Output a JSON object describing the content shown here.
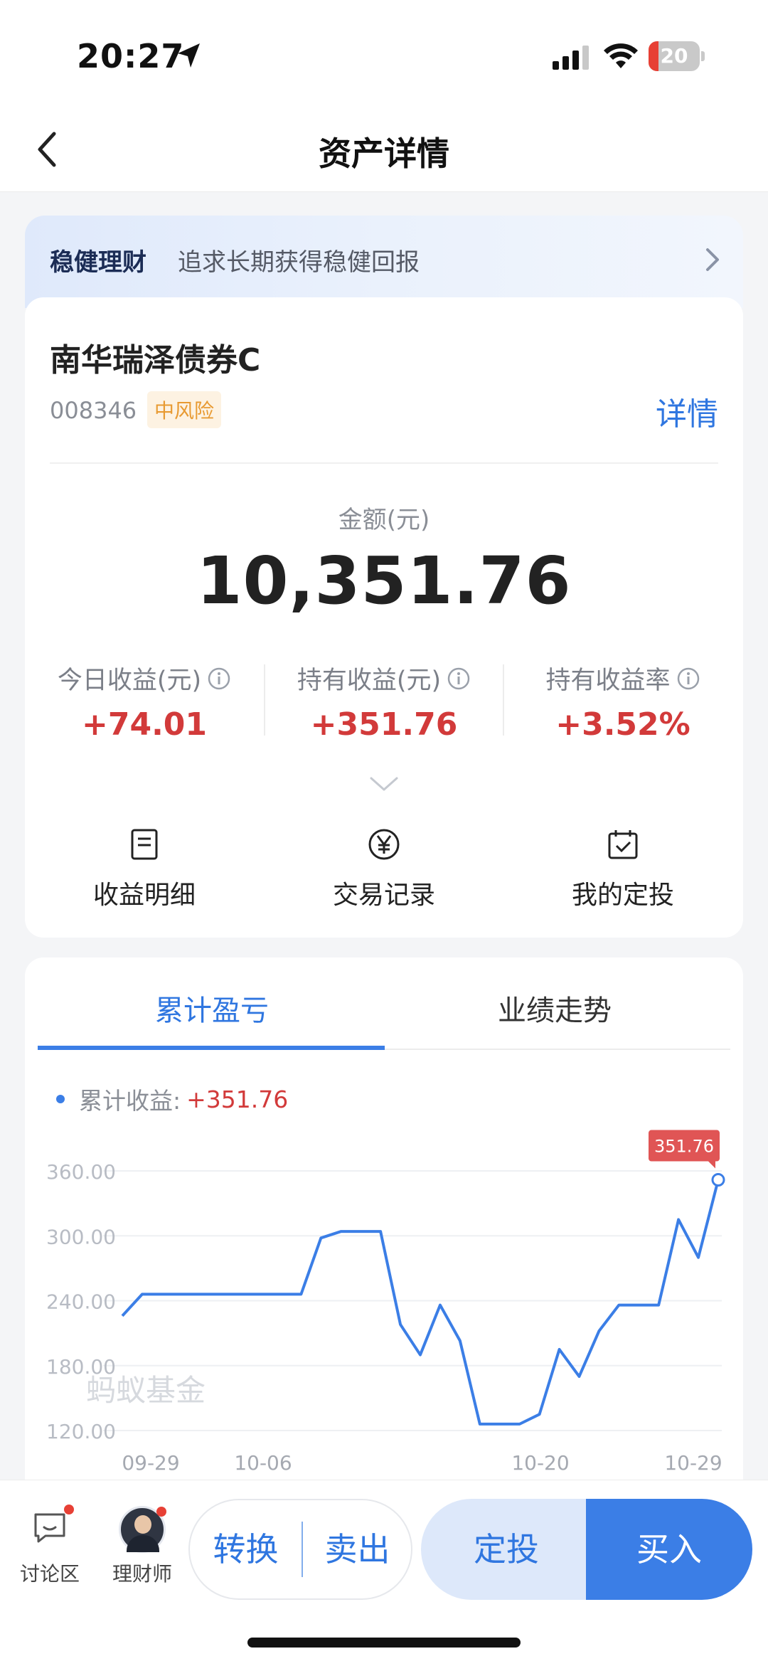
{
  "status_bar": {
    "time": "20:27",
    "battery": "20",
    "battery_level": 0.2
  },
  "header": {
    "title": "资产详情"
  },
  "banner": {
    "tag": "稳健理财",
    "text": "追求长期获得稳健回报"
  },
  "fund": {
    "name": "南华瑞泽债券C",
    "code": "008346",
    "risk": "中风险",
    "detail_link": "详情",
    "amount_label": "金额(元)",
    "amount": "10,351.76",
    "stats": [
      {
        "label": "今日收益(元)",
        "value": "+74.01"
      },
      {
        "label": "持有收益(元)",
        "value": "+351.76"
      },
      {
        "label": "持有收益率",
        "value": "+3.52%"
      }
    ],
    "quick_actions": [
      {
        "label": "收益明细",
        "icon": "document-icon"
      },
      {
        "label": "交易记录",
        "icon": "yen-circle-icon"
      },
      {
        "label": "我的定投",
        "icon": "calendar-check-icon"
      }
    ]
  },
  "tabs": [
    {
      "label": "累计盈亏",
      "active": true
    },
    {
      "label": "业绩走势",
      "active": false
    }
  ],
  "legend": {
    "label": "累计收益:",
    "value": "+351.76"
  },
  "watermark": "蚂蚁基金",
  "chart_data": {
    "type": "line",
    "series": [
      {
        "name": "累计收益",
        "values": [
          226,
          246,
          246,
          246,
          246,
          246,
          246,
          246,
          246,
          246,
          298,
          304,
          304,
          304,
          218,
          190,
          236,
          203,
          126,
          126,
          126,
          135,
          195,
          170,
          212,
          236,
          236,
          236,
          315,
          280,
          351.76
        ]
      }
    ],
    "x_tick_labels": [
      "09-29",
      "10-06",
      "10-20",
      "10-29"
    ],
    "y_ticks": [
      360,
      300,
      240,
      180,
      120
    ],
    "y_tick_labels": [
      "360.00",
      "300.00",
      "240.00",
      "180.00",
      "120.00"
    ],
    "ylim": [
      120,
      360
    ],
    "last_value_label": "351.76",
    "grid": true,
    "color": "#3b7ee6"
  },
  "bottom_bar": {
    "discuss": "讨论区",
    "advisor": "理财师",
    "convert": "转换",
    "sell": "卖出",
    "dingtou": "定投",
    "buy": "买入"
  },
  "colors": {
    "accent": "#3b7ee6",
    "positive": "#d23a3a",
    "risk": "#e89a32"
  }
}
